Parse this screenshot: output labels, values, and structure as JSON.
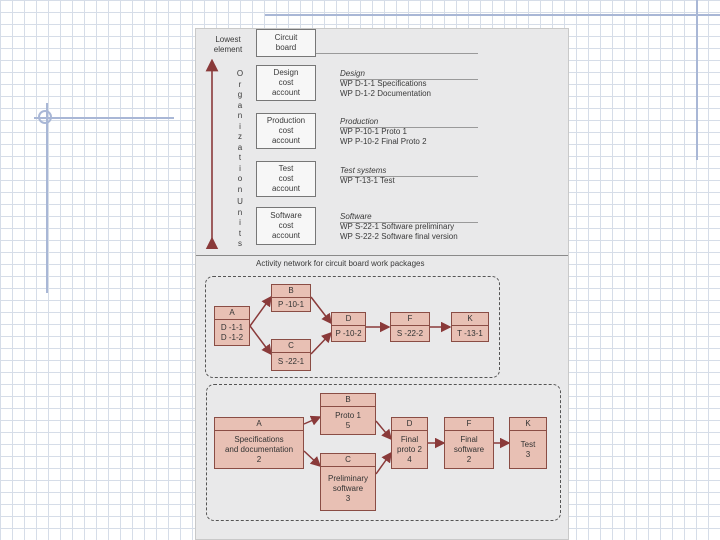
{
  "left_labels": {
    "lowest": "Lowest",
    "element": "element"
  },
  "vertical_label": {
    "top": "Organization",
    "bottom": "Units"
  },
  "circuit_board": [
    "Circuit",
    "board"
  ],
  "accounts": [
    {
      "box": [
        "Design",
        "cost",
        "account"
      ],
      "title": "Design",
      "wps": [
        "WP  D-1-1 Specifications",
        "WP  D-1-2 Documentation"
      ]
    },
    {
      "box": [
        "Production",
        "cost",
        "account"
      ],
      "title": "Production",
      "wps": [
        "WP  P-10-1 Proto 1",
        "WP  P-10-2 Final Proto 2"
      ]
    },
    {
      "box": [
        "Test",
        "cost",
        "account"
      ],
      "title": "Test systems",
      "wps": [
        "WP  T-13-1 Test"
      ]
    },
    {
      "box": [
        "Software",
        "cost",
        "account"
      ],
      "title": "Software",
      "wps": [
        "WP  S-22-1 Software preliminary",
        "WP  S-22-2 Software final version"
      ]
    }
  ],
  "network_title": "Activity network for circuit board work packages",
  "network1": {
    "A": {
      "id": "A",
      "body": [
        "D -1-1",
        "D -1-2"
      ]
    },
    "B": {
      "id": "B",
      "body": [
        "P -10-1"
      ]
    },
    "C": {
      "id": "C",
      "body": [
        "S -22-1"
      ]
    },
    "D": {
      "id": "D",
      "body": [
        "P -10-2"
      ]
    },
    "F": {
      "id": "F",
      "body": [
        "S -22-2"
      ]
    },
    "K": {
      "id": "K",
      "body": [
        "T -13-1"
      ]
    }
  },
  "network2": {
    "A": {
      "id": "A",
      "body": [
        "Specifications",
        "and documentation",
        "2"
      ]
    },
    "B": {
      "id": "B",
      "body": [
        "Proto 1",
        "5"
      ]
    },
    "C": {
      "id": "C",
      "body": [
        "Preliminary",
        "software",
        "3"
      ]
    },
    "D": {
      "id": "D",
      "body": [
        "Final",
        "proto 2",
        "4"
      ]
    },
    "F": {
      "id": "F",
      "body": [
        "Final",
        "software",
        "2"
      ]
    },
    "K": {
      "id": "K",
      "body": [
        "Test",
        "3"
      ]
    }
  }
}
